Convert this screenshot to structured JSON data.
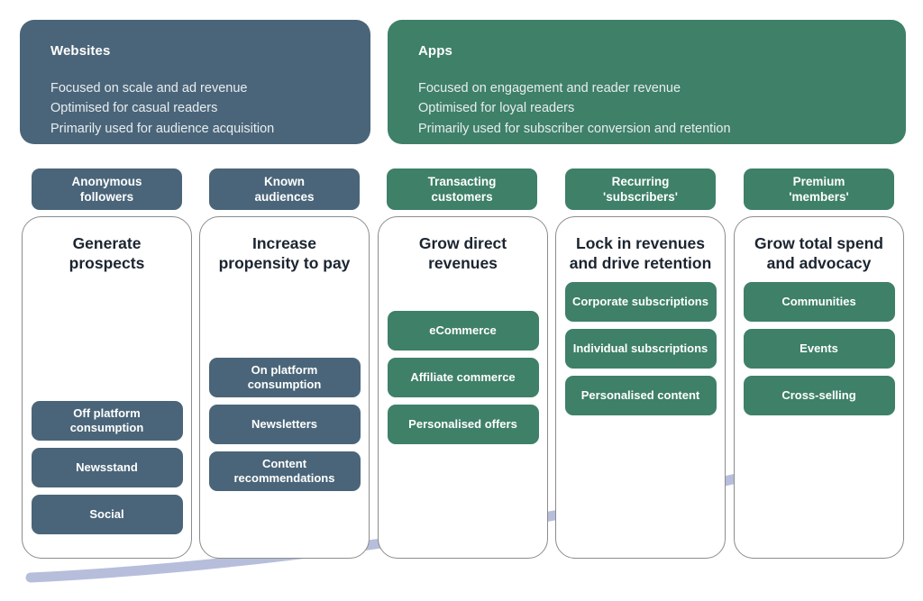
{
  "banners": [
    {
      "id": "websites",
      "title": "Websites",
      "lines": [
        "Focused on scale and ad revenue",
        "Optimised for casual readers",
        "Primarily used for audience acquisition"
      ],
      "color": "#4a6579"
    },
    {
      "id": "apps",
      "title": "Apps",
      "lines": [
        "Focused on engagement and reader revenue",
        "Optimised for loyal readers",
        "Primarily used for subscriber conversion and retention"
      ],
      "color": "#3e8068"
    }
  ],
  "stages": [
    {
      "pill": "Anonymous\nfollowers",
      "pill_line1": "Anonymous",
      "pill_line2": "followers",
      "theme": "blue",
      "heading": "Generate prospects",
      "tactics": [
        "Off platform consumption",
        "Newsstand",
        "Social"
      ]
    },
    {
      "pill_line1": "Known",
      "pill_line2": "audiences",
      "theme": "blue",
      "heading": "Increase propensity to pay",
      "tactics": [
        "On platform consumption",
        "Newsletters",
        "Content recommendations"
      ]
    },
    {
      "pill_line1": "Transacting",
      "pill_line2": "customers",
      "theme": "green",
      "heading": "Grow direct revenues",
      "tactics": [
        "eCommerce",
        "Affiliate commerce",
        "Personalised offers"
      ]
    },
    {
      "pill_line1": "Recurring",
      "pill_line2": "'subscribers'",
      "theme": "green",
      "heading": "Lock in revenues and drive retention",
      "tactics": [
        "Corporate subscriptions",
        "Individual subscriptions",
        "Personalised content"
      ]
    },
    {
      "pill_line1": "Premium",
      "pill_line2": "'members'",
      "theme": "green",
      "heading": "Grow total spend and advocacy",
      "tactics": [
        "Communities",
        "Events",
        "Cross-selling"
      ]
    }
  ],
  "arrow": {
    "name": "growth-arrow",
    "color": "#b6bedb"
  },
  "colors": {
    "blue": "#4a6579",
    "green": "#3e8068",
    "arrow": "#b6bedb",
    "card_border": "#8c8c8c",
    "heading_text": "#1b2430"
  }
}
